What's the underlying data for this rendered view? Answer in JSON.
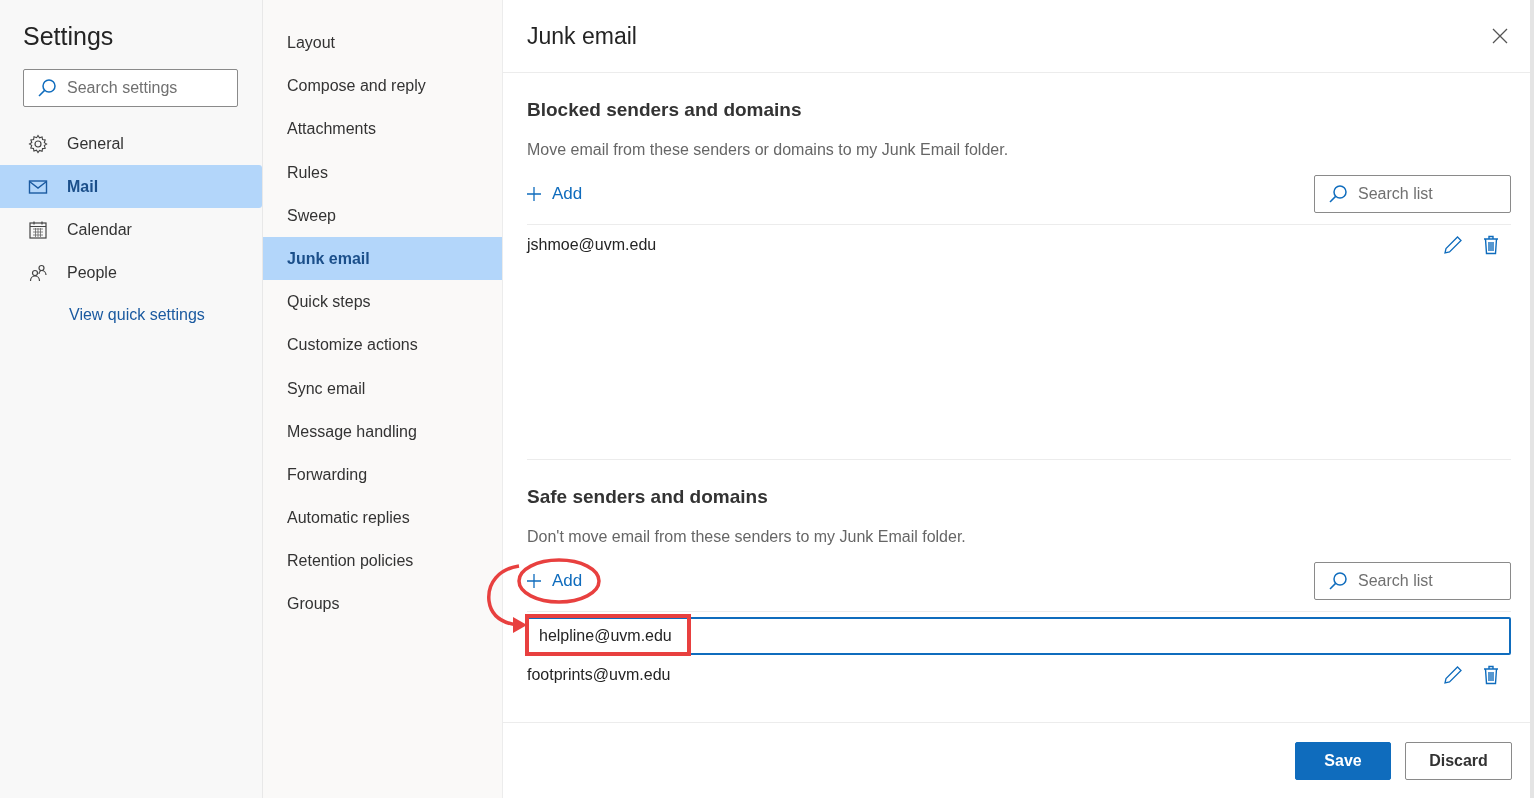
{
  "sidebar": {
    "title": "Settings",
    "search": {
      "placeholder": "Search settings"
    },
    "items": [
      {
        "label": "General",
        "kind": "gear",
        "selected": false
      },
      {
        "label": "Mail",
        "kind": "mail",
        "selected": true
      },
      {
        "label": "Calendar",
        "kind": "calendar",
        "selected": false
      },
      {
        "label": "People",
        "kind": "people",
        "selected": false
      }
    ],
    "link": "View quick settings"
  },
  "submenu": {
    "items": [
      {
        "label": "Layout",
        "selected": false
      },
      {
        "label": "Compose and reply",
        "selected": false
      },
      {
        "label": "Attachments",
        "selected": false
      },
      {
        "label": "Rules",
        "selected": false
      },
      {
        "label": "Sweep",
        "selected": false
      },
      {
        "label": "Junk email",
        "selected": true
      },
      {
        "label": "Quick steps",
        "selected": false
      },
      {
        "label": "Customize actions",
        "selected": false
      },
      {
        "label": "Sync email",
        "selected": false
      },
      {
        "label": "Message handling",
        "selected": false
      },
      {
        "label": "Forwarding",
        "selected": false
      },
      {
        "label": "Automatic replies",
        "selected": false
      },
      {
        "label": "Retention policies",
        "selected": false
      },
      {
        "label": "Groups",
        "selected": false
      }
    ]
  },
  "panel": {
    "title": "Junk email",
    "sections": [
      {
        "title": "Blocked senders and domains",
        "description": "Move email from these senders or domains to my Junk Email folder.",
        "add": "Add",
        "search": {
          "placeholder": "Search list"
        },
        "rows": [
          "jshmoe@uvm.edu"
        ]
      },
      {
        "title": "Safe senders and domains",
        "description": "Don't move email from these senders to my Junk Email folder.",
        "add": "Add",
        "search": {
          "placeholder": "Search list"
        },
        "input": {
          "value": "helpline@uvm.edu"
        },
        "rows": [
          "footprints@uvm.edu"
        ]
      }
    ]
  },
  "buttons": [
    {
      "label": "Save",
      "kind": "primary"
    },
    {
      "label": "Discard",
      "kind": "secondary"
    }
  ]
}
